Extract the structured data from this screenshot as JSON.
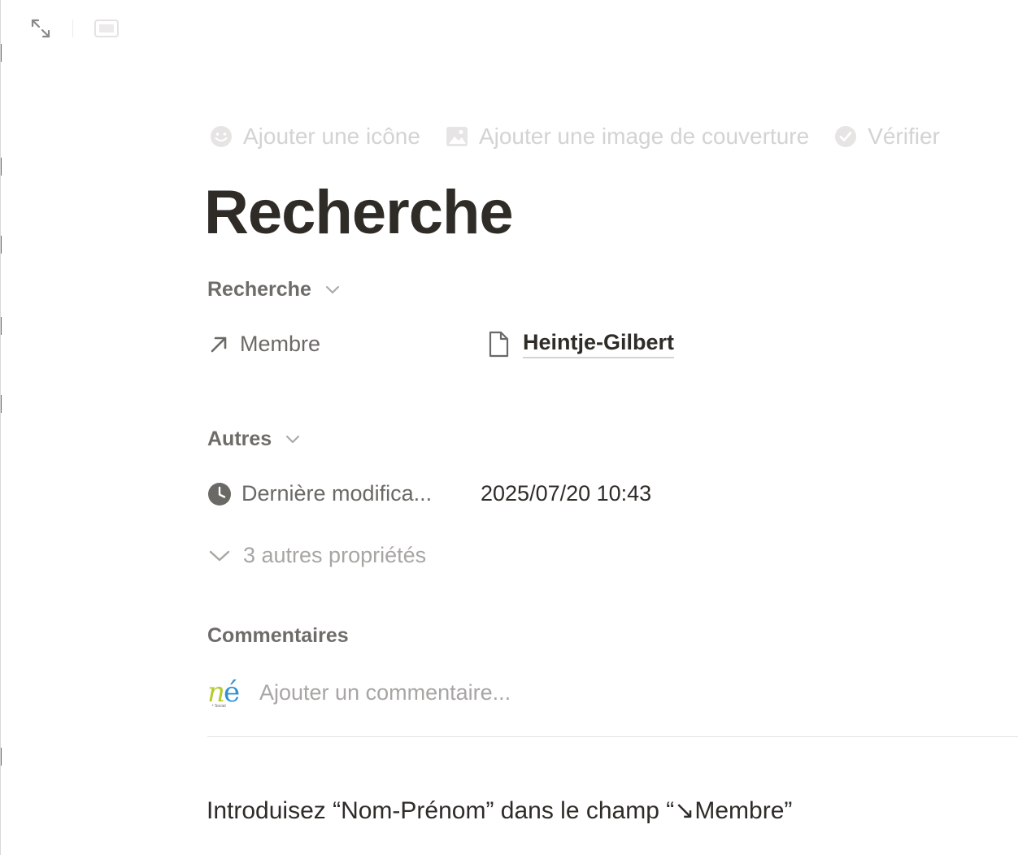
{
  "page_actions": {
    "add_icon_label": "Ajouter une icône",
    "add_cover_label": "Ajouter une image de couverture",
    "verify_label": "Vérifier"
  },
  "page": {
    "title": "Recherche"
  },
  "sections": {
    "recherche": {
      "label": "Recherche",
      "properties": {
        "membre": {
          "name": "Membre",
          "icon": "relation-arrow-icon",
          "value": "Heintje-Gilbert",
          "value_icon": "page-icon"
        }
      }
    },
    "autres": {
      "label": "Autres",
      "properties": {
        "last_modified": {
          "name": "Dernière modifica...",
          "icon": "clock-icon",
          "value": "2025/07/20 10:43"
        }
      },
      "more_label": "3 autres propriétés"
    }
  },
  "comments": {
    "heading": "Commentaires",
    "placeholder": "Ajouter un commentaire..."
  },
  "content": {
    "paragraph": "Introduisez “Nom-Prénom” dans le champ “↘Membre”"
  },
  "colors": {
    "text": "#37352f",
    "muted": "#6b6965",
    "faint": "#a7a6a2",
    "ghost": "#d3d3d1",
    "divider": "#e3e2e0"
  }
}
